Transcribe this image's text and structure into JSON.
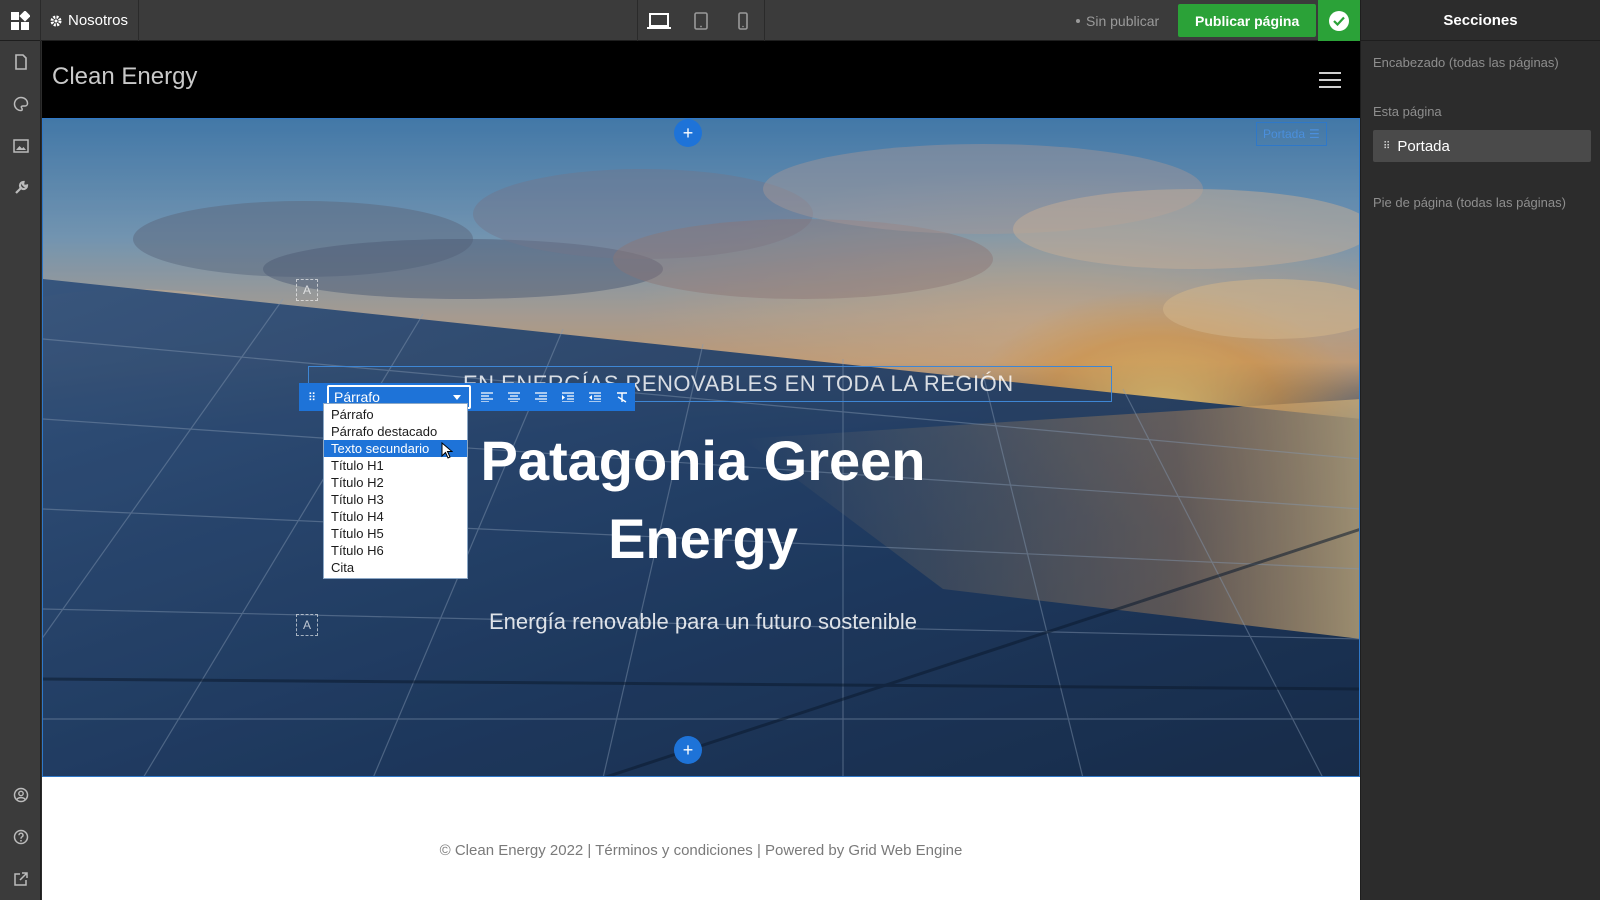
{
  "topbar": {
    "site_menu_label": "Nosotros",
    "status": "Sin publicar",
    "publish_label": "Publicar página"
  },
  "sidebar_right": {
    "title": "Secciones",
    "header_label": "Encabezado (todas las páginas)",
    "this_page_label": "Esta página",
    "section_name": "Portada",
    "footer_label": "Pie de página (todas las páginas)"
  },
  "site": {
    "name": "Clean Energy",
    "section_tag": "Portada",
    "tagline": "EN ENERGÍAS RENOVABLES EN TODA LA REGIÓN",
    "title": "Patagonia Green Energy",
    "subtitle": "Energía renovable para un futuro sostenible",
    "footer": "© Clean Energy 2022 | Términos y condiciones | Powered by Grid Web Engine"
  },
  "text_toolbar": {
    "selected_style": "Párrafo",
    "options": [
      "Párrafo",
      "Párrafo destacado",
      "Texto secundario",
      "Título H1",
      "Título H2",
      "Título H3",
      "Título H4",
      "Título H5",
      "Título H6",
      "Cita"
    ],
    "highlighted_option": "Texto secundario"
  },
  "icons": {
    "app_logo": "grid-logo-icon",
    "site_menu": "gear-icon",
    "devices": [
      "desktop-icon",
      "tablet-icon",
      "mobile-icon"
    ],
    "left_tools": [
      "page-icon",
      "palette-icon",
      "image-icon",
      "wrench-icon"
    ],
    "left_bottom": [
      "account-icon",
      "help-icon",
      "external-link-icon"
    ],
    "align": [
      "align-left-icon",
      "align-center-icon",
      "align-right-icon",
      "indent-icon",
      "outdent-icon",
      "clear-format-icon"
    ]
  },
  "colors": {
    "accent": "#1e73d8",
    "publish": "#2ba238"
  }
}
